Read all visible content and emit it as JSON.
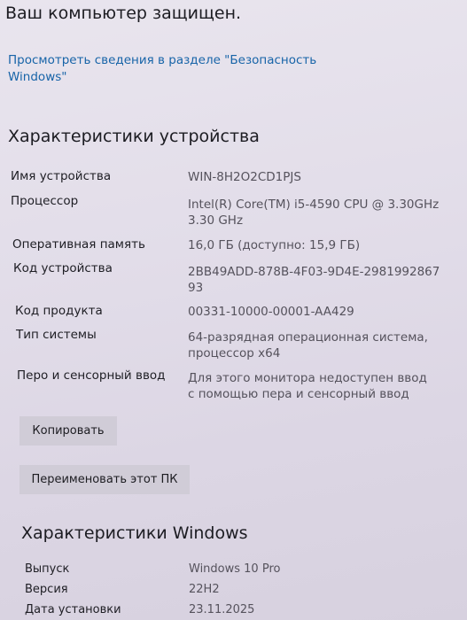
{
  "security": {
    "status": "Ваш компьютер защищен.",
    "link": "Просмотреть сведения в разделе \"Безопасность Windows\""
  },
  "device_specs": {
    "title": "Характеристики устройства",
    "rows": [
      {
        "label": "Имя устройства",
        "value": "WIN-8H2O2CD1PJS"
      },
      {
        "label": "Процессор",
        "value": "Intel(R) Core(TM) i5-4590 CPU @ 3.30GHz 3.30 GHz"
      },
      {
        "label": "Оперативная память",
        "value": "16,0 ГБ (доступно: 15,9 ГБ)"
      },
      {
        "label": "Код устройства",
        "value": "2BB49ADD-878B-4F03-9D4E-298199286793"
      },
      {
        "label": "Код продукта",
        "value": "00331-10000-00001-AA429"
      },
      {
        "label": "Тип системы",
        "value": "64-разрядная операционная система, процессор x64"
      },
      {
        "label": "Перо и сенсорный ввод",
        "value": "Для этого монитора недоступен ввод с помощью пера и сенсорный ввод"
      }
    ],
    "copy_button": "Копировать",
    "rename_button": "Переименовать этот ПК"
  },
  "windows_specs": {
    "title": "Характеристики Windows",
    "rows": [
      {
        "label": "Выпуск",
        "value": "Windows 10 Pro"
      },
      {
        "label": "Версия",
        "value": "22H2"
      },
      {
        "label": "Дата установки",
        "value": "23.11.2025"
      }
    ]
  }
}
